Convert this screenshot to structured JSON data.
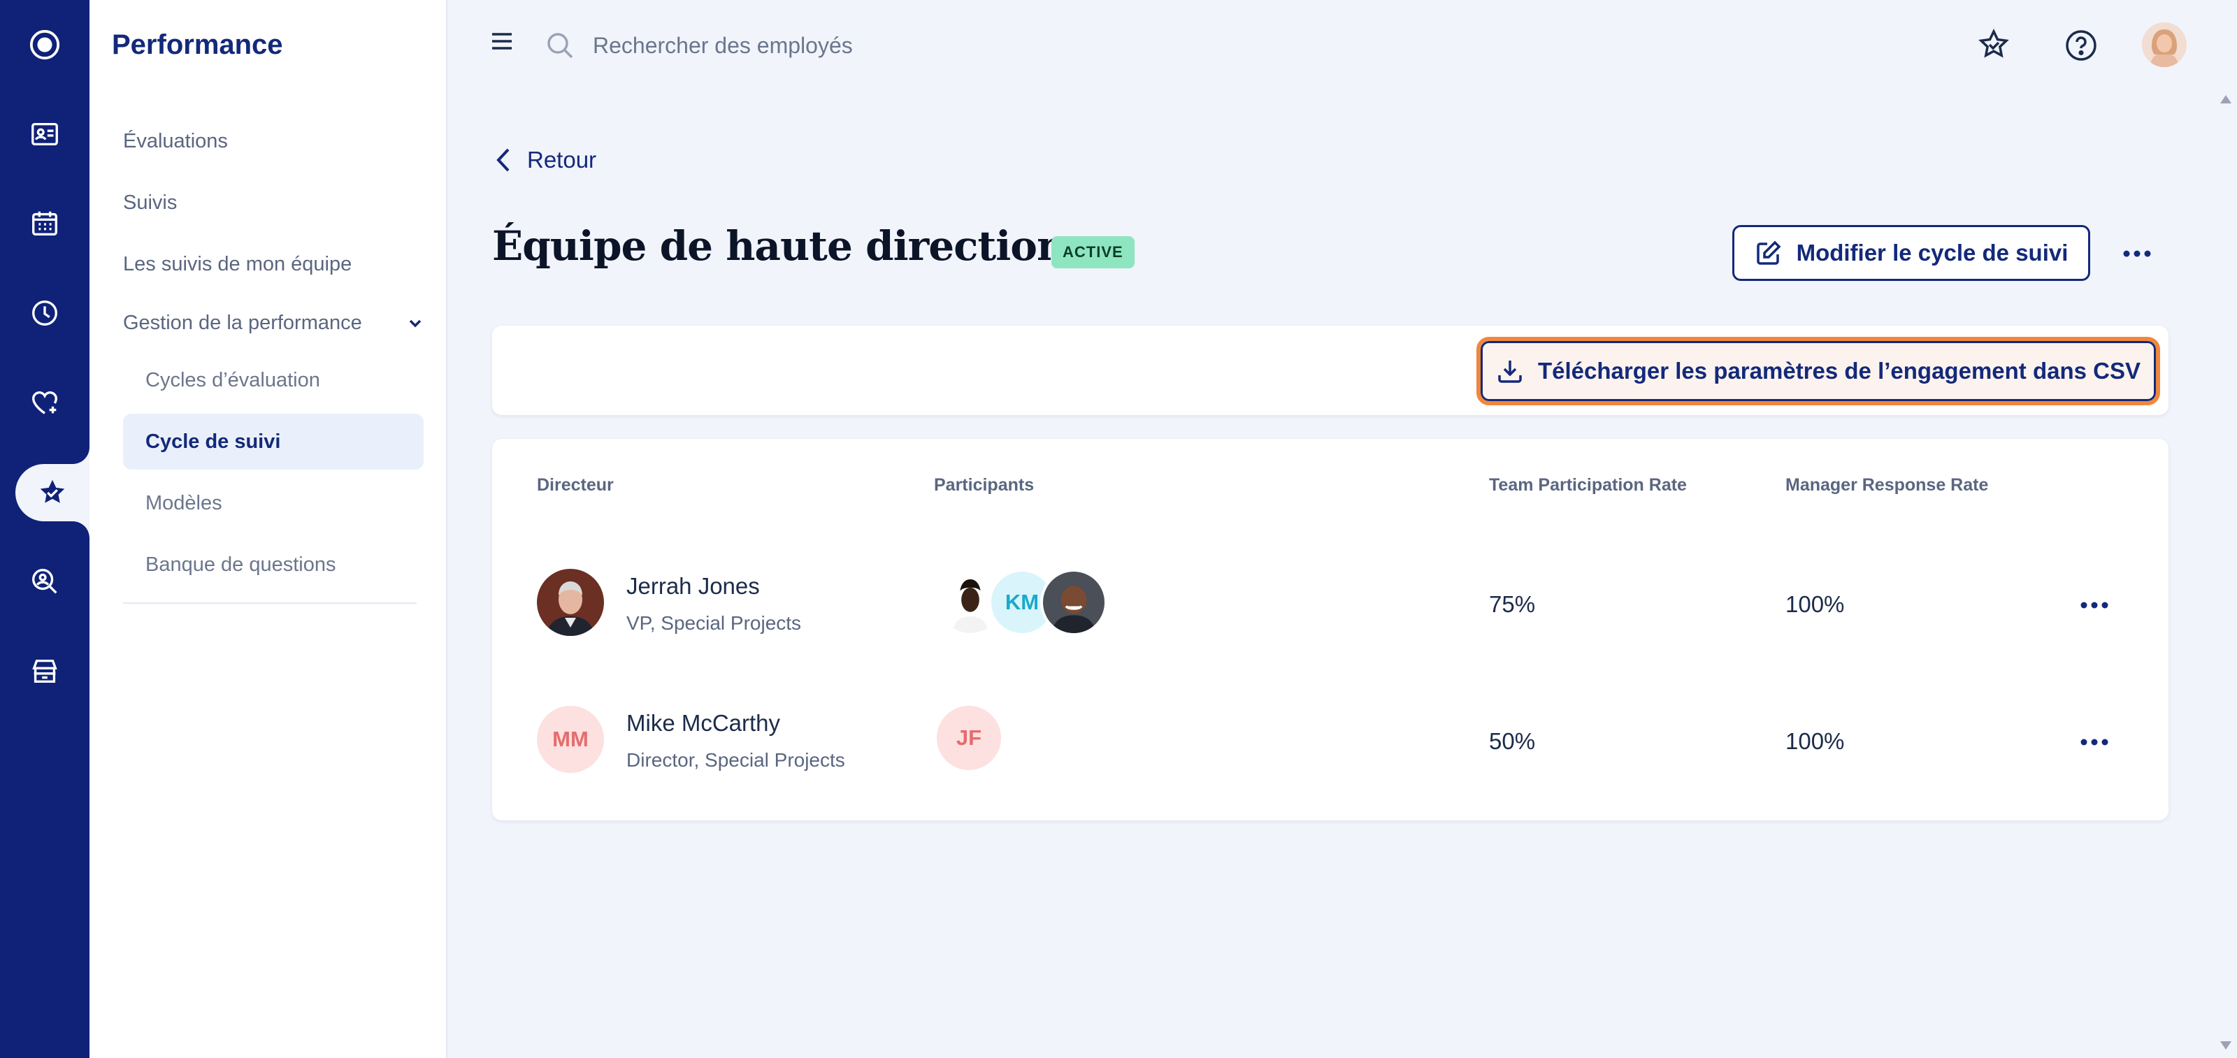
{
  "sidebar": {
    "title": "Performance",
    "items": [
      {
        "label": "Évaluations"
      },
      {
        "label": "Suivis"
      },
      {
        "label": "Les suivis de mon équipe"
      }
    ],
    "group": {
      "label": "Gestion de la performance",
      "children": [
        {
          "label": "Cycles d’évaluation"
        },
        {
          "label": "Cycle de suivi"
        },
        {
          "label": "Modèles"
        },
        {
          "label": "Banque de questions"
        }
      ]
    }
  },
  "topbar": {
    "search_placeholder": "Rechercher des employés"
  },
  "main": {
    "back_label": "Retour",
    "title": "Équipe de haute direction",
    "status_badge": "ACTIVE",
    "edit_button": "Modifier le cycle de suivi",
    "csv_button": "Télécharger les paramètres de l’engagement dans CSV",
    "table": {
      "headers": [
        "Directeur",
        "Participants",
        "Team Participation Rate",
        "Manager Response Rate"
      ],
      "rows": [
        {
          "name": "Jerrah Jones",
          "role": "VP, Special Projects",
          "participants": [
            "KM"
          ],
          "team_rate": "75%",
          "manager_rate": "100%"
        },
        {
          "name": "Mike McCarthy",
          "initials": "MM",
          "role": "Director, Special Projects",
          "participants": [
            "JF"
          ],
          "team_rate": "50%",
          "manager_rate": "100%"
        }
      ]
    }
  },
  "colors": {
    "rail": "#0f2278",
    "primary": "#13297a",
    "badge": "#8ee6c0",
    "highlight": "#f0873f"
  }
}
